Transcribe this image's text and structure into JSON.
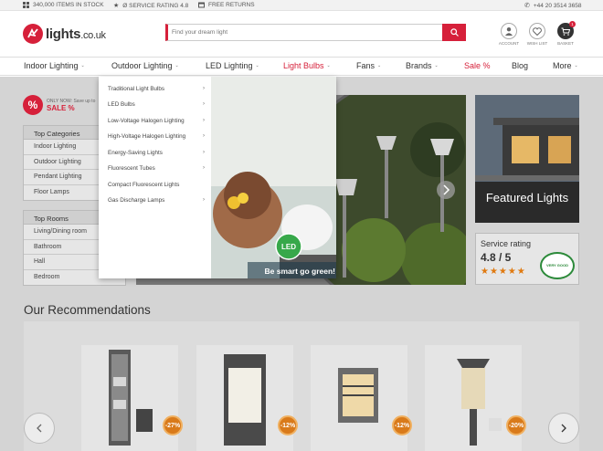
{
  "topbar": {
    "items_in_stock": "340,000 ITEMS IN STOCK",
    "service_rating": "Ø SERVICE RATING 4.8",
    "free_returns": "FREE RETURNS",
    "phone": "+44 20 3514 3658"
  },
  "header": {
    "logo_main": "lights",
    "logo_domain": ".co.uk",
    "search_placeholder": "Find your dream light",
    "account_label": "ACCOUNT",
    "wishlist_label": "WISH LIST",
    "basket_label": "BASKET",
    "basket_count": "1"
  },
  "nav": {
    "items": [
      {
        "label": "Indoor Lighting",
        "caret": "⌄"
      },
      {
        "label": "Outdoor Lighting",
        "caret": "⌄"
      },
      {
        "label": "LED Lighting",
        "caret": "⌄"
      },
      {
        "label": "Light Bulbs",
        "caret": "⌄"
      },
      {
        "label": "Fans",
        "caret": "⌄"
      },
      {
        "label": "Brands",
        "caret": "⌄"
      },
      {
        "label": "Sale %",
        "caret": ""
      },
      {
        "label": "Blog",
        "caret": ""
      },
      {
        "label": "More",
        "caret": "⌄"
      }
    ]
  },
  "dropdown": {
    "items": [
      {
        "label": "Traditional Light Bulbs",
        "arrow": "›"
      },
      {
        "label": "LED Bulbs",
        "arrow": "›"
      },
      {
        "label": "Low-Voltage Halogen Lighting",
        "arrow": "›"
      },
      {
        "label": "High-Voltage Halogen Lighting",
        "arrow": "›"
      },
      {
        "label": "Energy-Saving Lights",
        "arrow": "›"
      },
      {
        "label": "Fluorescent Tubes",
        "arrow": "›"
      },
      {
        "label": "Compact Fluorescent Lights",
        "arrow": ""
      },
      {
        "label": "Gas Discharge Lamps",
        "arrow": "›"
      }
    ],
    "promo_badge": "LED",
    "promo_text": "Be smart go green!"
  },
  "sidebar": {
    "sale_small": "ONLY NOW: Save up to",
    "sale_big": "SALE %",
    "sale_symbol": "%",
    "categories_title": "Top Categories",
    "categories": [
      "Indoor Lighting",
      "Outdoor Lighting",
      "Pendant Lighting",
      "Floor Lamps"
    ],
    "rooms_title": "Top Rooms",
    "rooms": [
      "Living/Dining room",
      "Bathroom",
      "Hall",
      "Bedroom"
    ]
  },
  "featured": {
    "label": "Featured Lights"
  },
  "rating": {
    "label": "Service rating",
    "value": "4.8 / 5",
    "stars": "★★★★★",
    "seal_text": "VERY GOOD"
  },
  "recommendations": {
    "title": "Our Recommendations",
    "products": [
      {
        "discount": "-27%"
      },
      {
        "discount": "-12%"
      },
      {
        "discount": "-12%"
      },
      {
        "discount": "-20%"
      }
    ]
  },
  "colors": {
    "brand": "#d6203a",
    "discount": "#d97a1a"
  },
  "icons": [
    "grid-icon",
    "star-icon",
    "return-icon",
    "phone-icon",
    "search-icon",
    "user-icon",
    "heart-icon",
    "cart-icon",
    "chevron-left-icon",
    "chevron-right-icon"
  ]
}
